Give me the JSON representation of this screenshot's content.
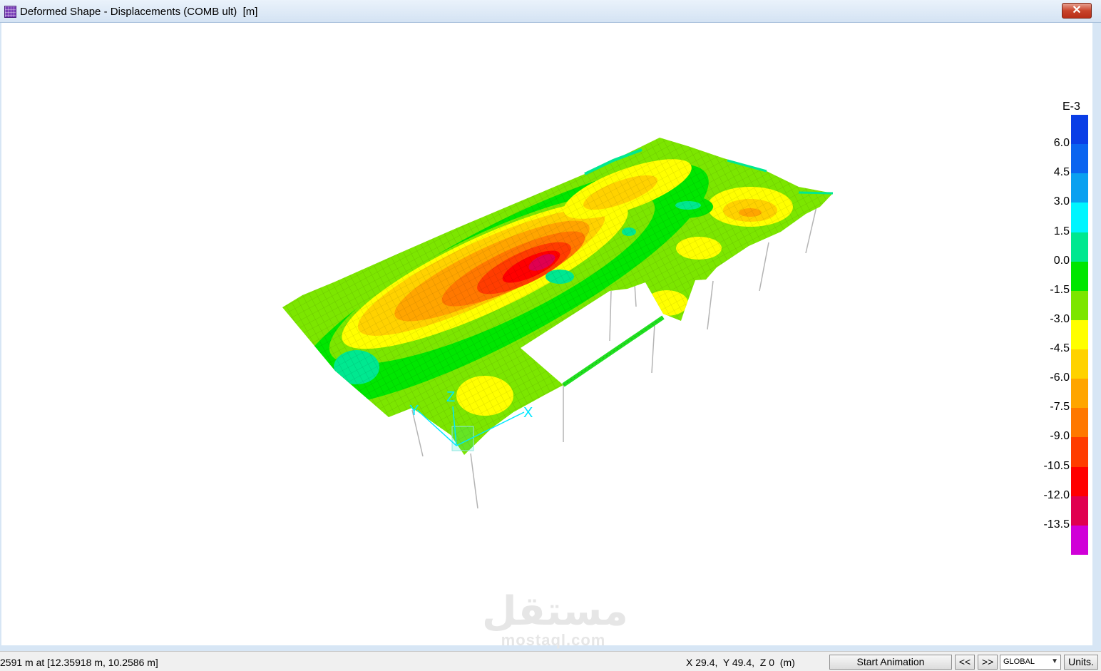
{
  "window": {
    "title": "Deformed Shape - Displacements (COMB ult)  [m]",
    "close_label": "✕"
  },
  "legend": {
    "unit": "E-3",
    "ticks": [
      "6.0",
      "4.5",
      "3.0",
      "1.5",
      "0.0",
      "-1.5",
      "-3.0",
      "-4.5",
      "-6.0",
      "-7.5",
      "-9.0",
      "-10.5",
      "-12.0",
      "-13.5"
    ],
    "colors": [
      "#0a3ee6",
      "#0a64f0",
      "#0aa0f0",
      "#00f5ff",
      "#00e890",
      "#00e600",
      "#7ce600",
      "#ffff00",
      "#ffd200",
      "#ffa500",
      "#ff7800",
      "#ff3c00",
      "#ff0000",
      "#e00050",
      "#d000d8"
    ]
  },
  "axes": {
    "x": "X",
    "y": "Y",
    "z": "Z"
  },
  "watermark": {
    "arabic": "مستقل",
    "latin": "mostaql.com"
  },
  "status": {
    "left_text": "2591 m at [12.35918 m, 10.2586 m]",
    "coords": "X 29.4,  Y 49.4,  Z 0  (m)",
    "start_animation": "Start Animation",
    "prev": "<<",
    "next": ">>",
    "coord_system": "GLOBAL",
    "units": "Units."
  }
}
